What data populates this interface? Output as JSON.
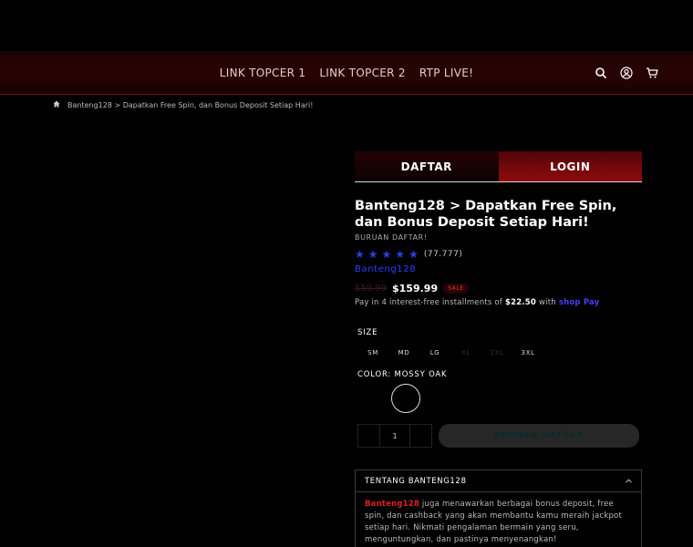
{
  "nav": {
    "items": [
      "LINK TOPCER 1",
      "LINK TOPCER 2",
      "RTP LIVE!"
    ]
  },
  "icons": {
    "search": "search-icon",
    "account": "user-icon",
    "cart": "cart-icon",
    "home": "home-icon"
  },
  "breadcrumb": {
    "current": "Banteng128 > Dapatkan Free Spin, dan Bonus Deposit Setiap Hari!"
  },
  "tabs": {
    "daftar": "DAFTAR",
    "login": "LOGIN"
  },
  "product": {
    "title": "Banteng128 > Dapatkan Free Spin, dan Bonus Deposit Setiap Hari!",
    "subtitle": "BURUAN DAFTAR!",
    "rating_stars": 5,
    "rating_count": "(77.777)",
    "vendor": "Banteng128",
    "old_price": "$59.99",
    "price": "$159.99",
    "sale_badge": "SALE",
    "installment_prefix": "Pay in 4 interest-free installments of",
    "installment_amount": "$22.50",
    "installment_with": "with",
    "installment_brand": "shop Pay"
  },
  "options": {
    "size_label": "SIZE",
    "sizes": [
      {
        "label": "SM",
        "available": true
      },
      {
        "label": "MD",
        "available": true
      },
      {
        "label": "LG",
        "available": true
      },
      {
        "label": "XL",
        "available": false
      },
      {
        "label": "2XL",
        "available": false
      },
      {
        "label": "3XL",
        "available": true
      }
    ],
    "color_label": "COLOR: MOSSY OAK"
  },
  "quantity": {
    "minus": "",
    "value": "1",
    "plus": ""
  },
  "buy_button": "BURUAN DAFTAR",
  "accordion": {
    "title": "TENTANG BANTENG128",
    "brand": "Banteng128",
    "body": " juga menawarkan berbagai bonus deposit, free spin, dan cashback yang akan membantu kamu meraih jackpot setiap hari. Nikmati pengalaman bermain yang seru, menguntungkan, dan pastinya menyenangkan!"
  },
  "colors": {
    "accent_red": "#8e0b0e",
    "brand_blue": "#2f3cff",
    "star_blue": "#2b3ee0",
    "header_bg": "#2a0405"
  }
}
